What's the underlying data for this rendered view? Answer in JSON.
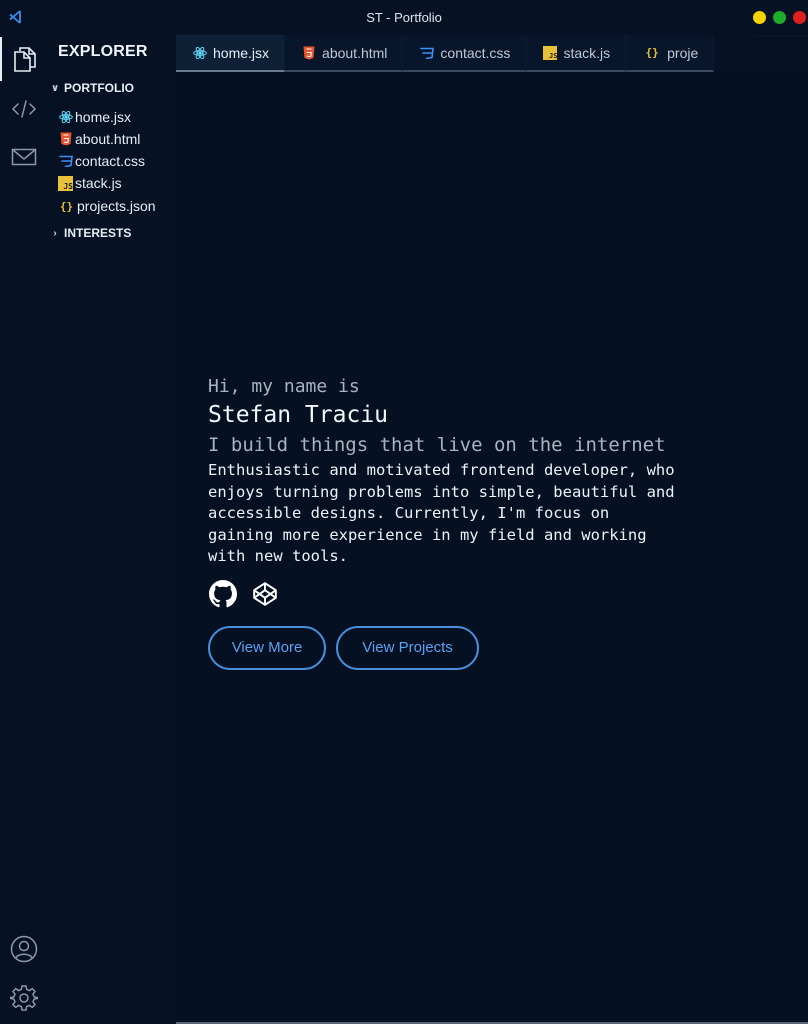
{
  "window": {
    "title": "ST - Portfolio",
    "controls": [
      {
        "name": "minimize",
        "color": "#f5d300"
      },
      {
        "name": "maximize",
        "color": "#1eaa2a"
      },
      {
        "name": "close",
        "color": "#e0201e"
      }
    ]
  },
  "activity_bar": {
    "items": [
      "explorer-icon",
      "code-icon",
      "mail-icon"
    ],
    "bottom": [
      "account-icon",
      "gear-icon"
    ]
  },
  "explorer": {
    "header": "EXPLORER",
    "portfolio_section": "PORTFOLIO",
    "interests_section": "INTERESTS",
    "files": [
      {
        "name": "home.jsx",
        "icon": "react-icon",
        "color": "#5ed3f3"
      },
      {
        "name": "about.html",
        "icon": "html5-icon",
        "color": "#e8542f"
      },
      {
        "name": "contact.css",
        "icon": "css3-icon",
        "color": "#3f8ff5"
      },
      {
        "name": "stack.js",
        "icon": "js-icon",
        "color": "#e8c13a"
      },
      {
        "name": "projects.json",
        "icon": "json-icon",
        "color": "#e8c13a"
      }
    ]
  },
  "tabs": [
    {
      "label": "home.jsx",
      "active": true
    },
    {
      "label": "about.html",
      "active": false
    },
    {
      "label": "contact.css",
      "active": false
    },
    {
      "label": "stack.js",
      "active": false
    },
    {
      "label": "proje",
      "active": false
    }
  ],
  "hero": {
    "greeting": "Hi, my name is",
    "name": "Stefan Traciu",
    "tagline": "I build things that live on the internet",
    "bio": "Enthusiastic and motivated frontend developer, who enjoys turning problems into simple, beautiful and accessible designs. Currently, I'm focus on gaining more experience in my field and working with new tools.",
    "socials": [
      "github-icon",
      "codepen-icon"
    ],
    "buttons": {
      "view_more": "View More",
      "view_projects": "View Projects"
    }
  },
  "colors": {
    "background": "#051022",
    "accent": "#4a8fde"
  }
}
